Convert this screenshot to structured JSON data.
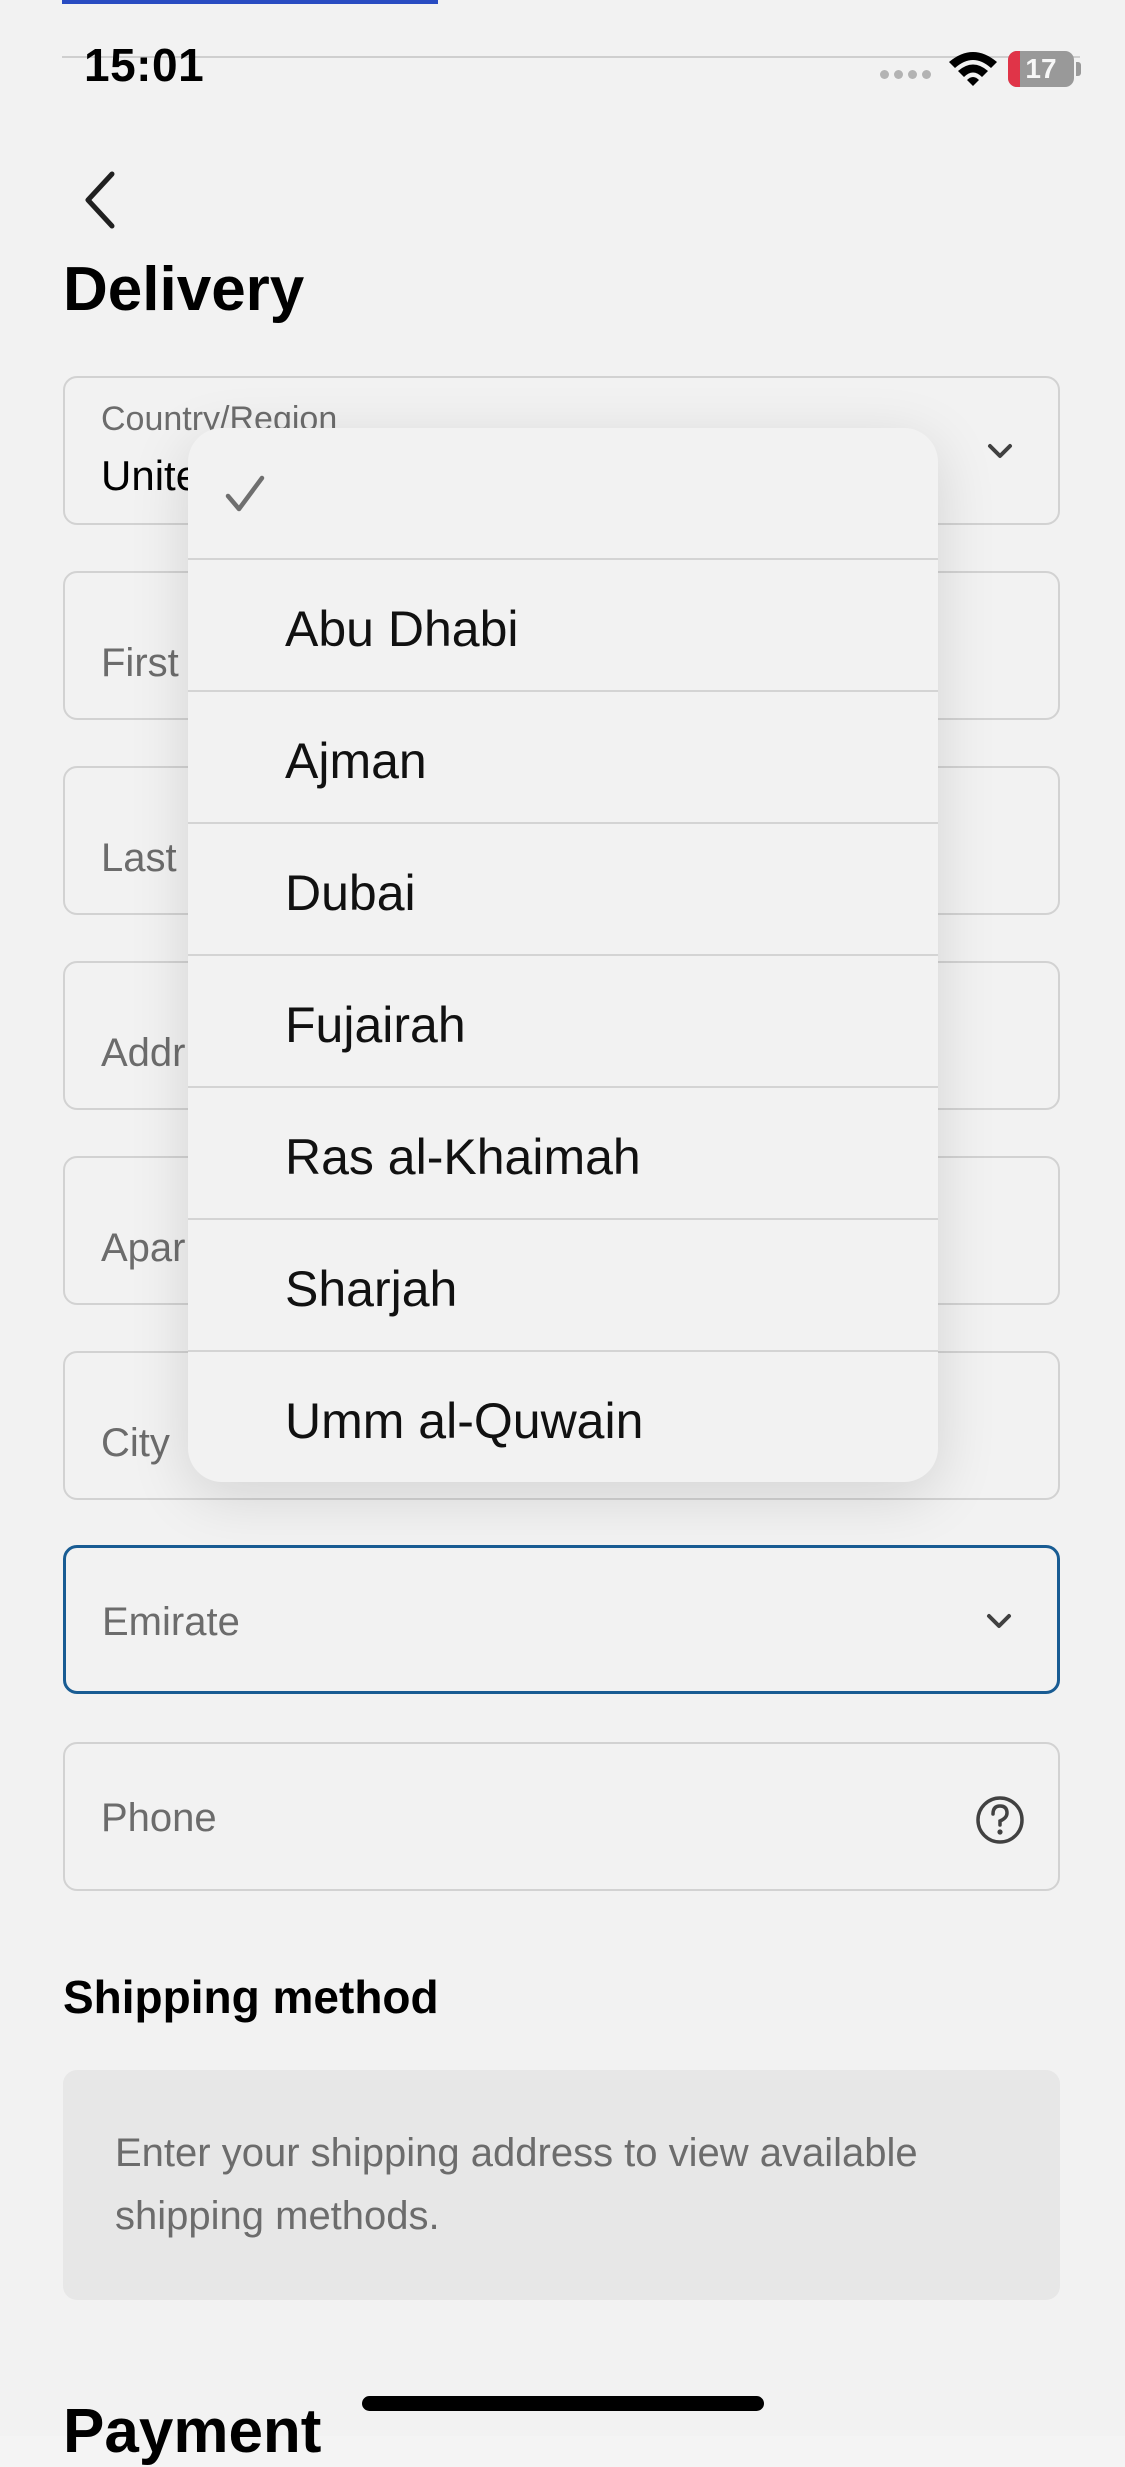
{
  "status_bar": {
    "time": "15:01",
    "battery": "17",
    "icons": [
      "wifi-icon",
      "battery-icon",
      "signal-icon"
    ]
  },
  "header": {
    "back_icon": "chevron-left-icon",
    "title": "Delivery"
  },
  "form": {
    "country": {
      "label": "Country/Region",
      "value": "Unite"
    },
    "first_name": {
      "placeholder": "First"
    },
    "last_name": {
      "placeholder": "Last"
    },
    "address": {
      "placeholder": "Addr"
    },
    "apartment": {
      "placeholder": "Apar"
    },
    "city": {
      "placeholder": "City"
    },
    "emirate": {
      "placeholder": "Emirate"
    },
    "phone": {
      "placeholder": "Phone"
    }
  },
  "dropdown": {
    "options": [
      "",
      "Abu Dhabi",
      "Ajman",
      "Dubai",
      "Fujairah",
      "Ras al-Khaimah",
      "Sharjah",
      "Umm al-Quwain"
    ],
    "selected_index": 0
  },
  "shipping": {
    "title": "Shipping method",
    "info": "Enter your shipping address to view available shipping methods."
  },
  "payment": {
    "title": "Payment"
  },
  "colors": {
    "focus_border": "#1a5f98",
    "battery_low": "#e8364b",
    "top_link": "#2b4fc9"
  }
}
